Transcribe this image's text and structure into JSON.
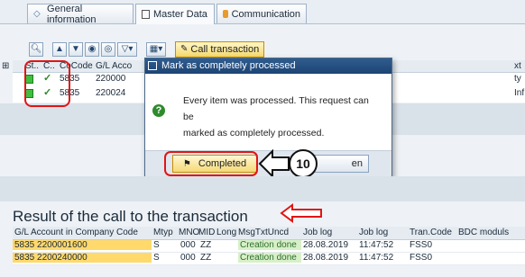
{
  "tabs": [
    {
      "label": "General information",
      "icon": "diamond-icon"
    },
    {
      "label": "Master Data",
      "icon": "list-icon"
    },
    {
      "label": "Communication",
      "icon": "communication-icon"
    }
  ],
  "toolbar": {
    "call_transaction_label": "Call transaction"
  },
  "grid1": {
    "headers": {
      "st": "St..",
      "c": "C..",
      "cocode": "CoCode",
      "gl": "G/L Acco",
      "e": "E",
      "ext": "xt"
    },
    "rows": [
      {
        "cocode": "5835",
        "gl": "220000",
        "ext": "ty"
      },
      {
        "cocode": "5835",
        "gl": "220024",
        "ext": "Inf"
      }
    ]
  },
  "dialog": {
    "title": "Mark as completely processed",
    "line1": "Every item was processed. This request can be",
    "line2": "marked as completely processed.",
    "completed_label": "Completed",
    "cancel_label": "en"
  },
  "annotation": {
    "step_number": "10"
  },
  "result": {
    "title": "Result of the call to the transaction",
    "headers": {
      "gl": "G/L Account in Company Code",
      "mtyp": "Mtyp",
      "mno": "MNO",
      "mid": "MID",
      "long": "Long",
      "msgtxt": "MsgTxtUncd",
      "joblog1": "Job log",
      "joblog2": "Job log",
      "tcode": "Tran.Code",
      "bdc": "BDC moduls"
    },
    "rows": [
      {
        "gl": "5835 2200001600",
        "mtyp": "S",
        "mno": "000",
        "mid": "ZZ",
        "msgtxt": "Creation done",
        "date": "28.08.2019",
        "time": "11:47:52",
        "tcode": "FSS0"
      },
      {
        "gl": "5835 2200240000",
        "mtyp": "S",
        "mno": "000",
        "mid": "ZZ",
        "msgtxt": "Creation done",
        "date": "28.08.2019",
        "time": "11:47:52",
        "tcode": "FSS0"
      }
    ]
  },
  "colors": {
    "accent_red": "#e01515",
    "title_bar": "#1d4475",
    "button_yellow": "#f6d977"
  }
}
